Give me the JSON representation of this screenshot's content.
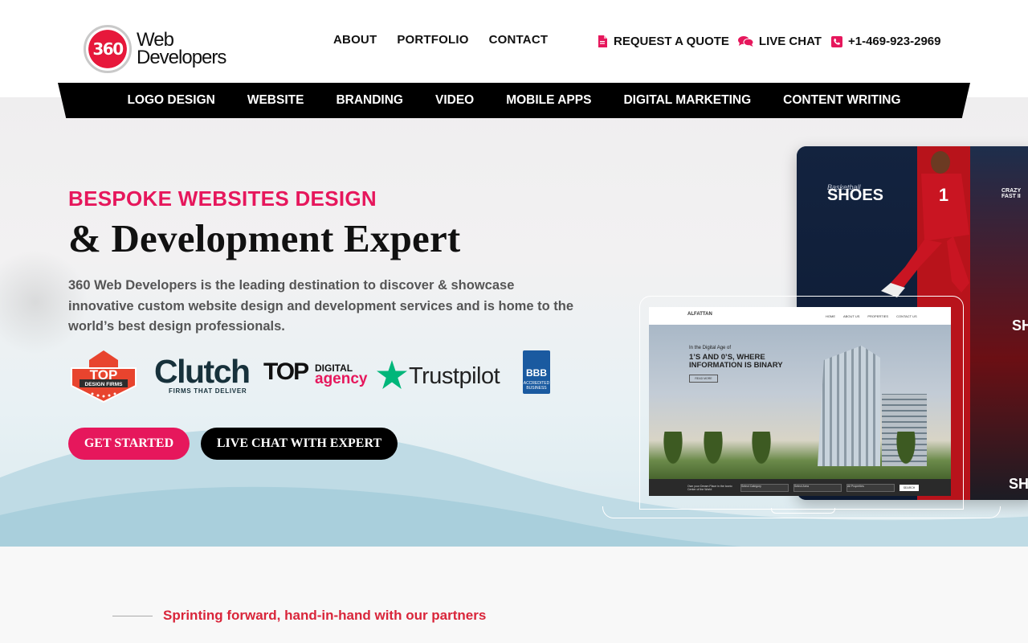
{
  "brand": {
    "logo_badge": "360",
    "logo_line1": "Web",
    "logo_line2": "Developers"
  },
  "top_nav": {
    "about": "ABOUT",
    "portfolio": "PORTFOLIO",
    "contact": "CONTACT"
  },
  "cta": {
    "quote": "REQUEST A QUOTE",
    "chat": "LIVE CHAT",
    "phone": "+1-469-923-2969"
  },
  "service_nav": [
    "LOGO DESIGN",
    "WEBSITE",
    "BRANDING",
    "VIDEO",
    "MOBILE APPS",
    "DIGITAL MARKETING",
    "CONTENT WRITING"
  ],
  "hero": {
    "kicker": "BESPOKE WEBSITES DESIGN",
    "headline": "& Development Expert",
    "description": "360 Web Developers is the leading destination to discover & showcase innovative custom website design and development services and is home to the world’s best design professionals.",
    "btn_start": "GET STARTED",
    "btn_chat": "LIVE CHAT WITH EXPERT"
  },
  "badges": {
    "top_design": {
      "line1": "TOP",
      "line2": "DESIGN FIRMS"
    },
    "clutch": {
      "name": "Clutch",
      "tagline": "FIRMS THAT DELIVER"
    },
    "top_digital": {
      "top": "TOP",
      "digital": "DIGITAL",
      "agency": "agency"
    },
    "trustpilot": {
      "name": "Trustpilot"
    },
    "bbb": {
      "name": "BBB",
      "sub": "ACCREDITED BUSINESS"
    }
  },
  "mockup": {
    "tablet_title": "SHOES",
    "tablet_kicker": "Basketball",
    "tablet_side": "CRAZY FAST II",
    "tablet_title_2": "SH",
    "tablet_title_3": "SH",
    "laptop_logo": "ALFATTAN",
    "laptop_nav": [
      "HOME",
      "ABOUT US",
      "PROPERTIES",
      "CONTACT US"
    ],
    "laptop_hero_small": "In the Digital Age of",
    "laptop_hero_big": "1’S AND 0’S, WHERE INFORMATION IS BINARY",
    "laptop_read_more": "READ MORE",
    "laptop_search_label": "Own your Dream Place in the Iconic Center of the World",
    "laptop_selects": [
      "Select Category",
      "Select Area",
      "All Properties"
    ],
    "laptop_search_btn": "SEARCH"
  },
  "partners": {
    "tagline": "Sprinting forward, hand-in-hand with our partners"
  },
  "colors": {
    "accent": "#e6175c",
    "dark": "#000000",
    "partner_red": "#d9253a"
  }
}
